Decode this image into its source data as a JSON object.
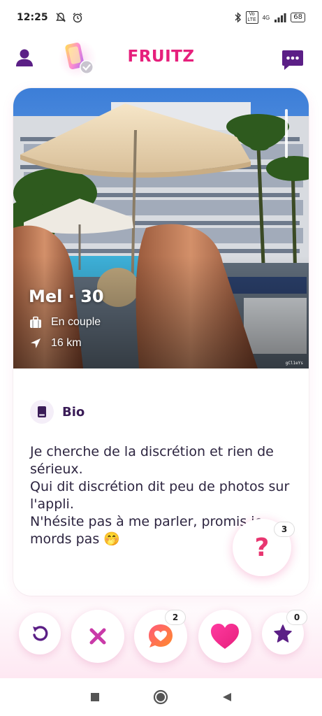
{
  "status_bar": {
    "time": "12:25",
    "network_label": "4G",
    "volte_label": "Vo LTE",
    "battery": "68"
  },
  "header": {
    "title": "FRUITZ",
    "profile_icon": "person-icon",
    "boost_icon": "boost-phone-icon",
    "chat_icon": "chat-icon",
    "brand_color": "#e6207c",
    "accent_color": "#5b1f86"
  },
  "profile": {
    "name_age": "Mel · 30",
    "relationship": "En couple",
    "distance": "16 km",
    "photo_watermark": "gCl1eYs",
    "photo_index_fraction": 0.12
  },
  "bio": {
    "title": "Bio",
    "text": "Je cherche de la discrétion et rien de sérieux.\nQui dit discrétion dit peu de photos sur l'appli.\nN'hésite pas à me parler, promis je mords pas 🤭"
  },
  "question_button": {
    "label": "?",
    "badge": "3"
  },
  "actions": {
    "rewind_icon": "rewind-icon",
    "pass_icon": "close-icon",
    "message_icon": "heart-message-icon",
    "message_badge": "2",
    "like_icon": "heart-icon",
    "super_like_icon": "star-icon",
    "super_like_badge": "0"
  },
  "system_nav": {
    "recent_icon": "square-icon",
    "home_icon": "circle-icon",
    "back_icon": "back-triangle-icon"
  }
}
